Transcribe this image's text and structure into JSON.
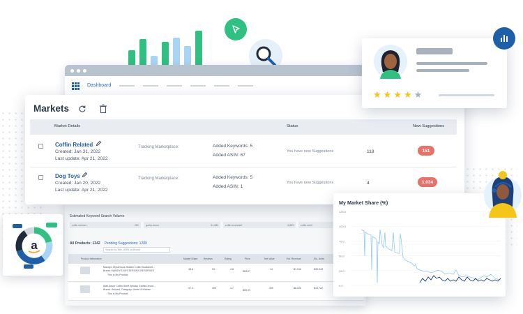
{
  "colors": {
    "brand_blue": "#1d5fa8",
    "link_blue": "#1f5fa6",
    "green": "#2fc082",
    "light_blue": "#a9d5f5",
    "pill_red": "#e8726a",
    "star_gold": "#f5c518",
    "star_gray": "#a7b1bd"
  },
  "dashboard": {
    "nav_label": "Dashboard"
  },
  "markets": {
    "title": "Markets",
    "columns": {
      "details": "Market Details",
      "status": "Status",
      "new_suggestions": "New Suggestions"
    },
    "rows": [
      {
        "name": "Coffin Related",
        "created": "Created: Jan 31, 2022",
        "updated": "Last update: Apr 21, 2022",
        "tracking": "Tracking Marketplace:",
        "keywords": "Added Keywords: 5",
        "asin": "Added ASIN: 67",
        "status": "You have new Suggestions",
        "count": "118",
        "suggestions": "151"
      },
      {
        "name": "Dog Toys",
        "created": "Created: Jan 20, 2022",
        "updated": "Last update: Apr 21, 2022",
        "tracking": "Tracking Marketplace:",
        "keywords": "Added Keywords: 5",
        "asin": "Added ASIN: 1",
        "status": "You have new Suggestions",
        "count": "4",
        "suggestions": "1,034"
      }
    ]
  },
  "lower_table": {
    "section_title": "Estimated Keyword Search Volume",
    "keyword_chips": [
      {
        "term": "coffin shelves",
        "volume": "281"
      },
      {
        "term": "gothic decor",
        "volume": "51,480"
      },
      {
        "term": "coffin bookshelf",
        "volume": "4,853"
      },
      {
        "term": "coffin shelf",
        "volume": "625"
      }
    ],
    "all_products": "All Products: 1342",
    "pending": "Pending Suggestions: 1289",
    "search_placeholder": "Search by Title, ASIN, or Brand",
    "columns": [
      "Product Information",
      "Market Share",
      "Reviews",
      "Rating",
      "Price",
      "Net Value",
      "Est. Revenue",
      "Est. Units"
    ],
    "products": [
      {
        "title": "Mandy's Mysterious Hidden Coffin Bookshelf...",
        "brand": "Brand: MANDY'S MYSTERIOUS RESERVES",
        "note": "This is My Product",
        "share": "48.6",
        "reviews": "93",
        "rating": "4.8",
        "price": "$53.67",
        "net": "14",
        "revenue": "$1,016",
        "units": "$35,943"
      },
      {
        "title": "Wall Decor Coffin Shelf Spooky Gothic Decor...",
        "brand": "Brand: Unused, Category: Home & Kitchen",
        "note": "This is My Product",
        "share": "37.4",
        "reviews": "306",
        "rating": "4.7",
        "price": "$59.99",
        "net": "300",
        "revenue": "$8,025",
        "units": "$16,722"
      }
    ]
  },
  "share_chart": {
    "title": "My Market Share (%)",
    "y_ticks": [
      "125.0",
      "100.0",
      "75.0",
      "50.0",
      "25.0",
      "0.0"
    ],
    "ylim": [
      0,
      125
    ]
  },
  "review": {
    "rating_stars": 4,
    "max_stars": 5
  }
}
